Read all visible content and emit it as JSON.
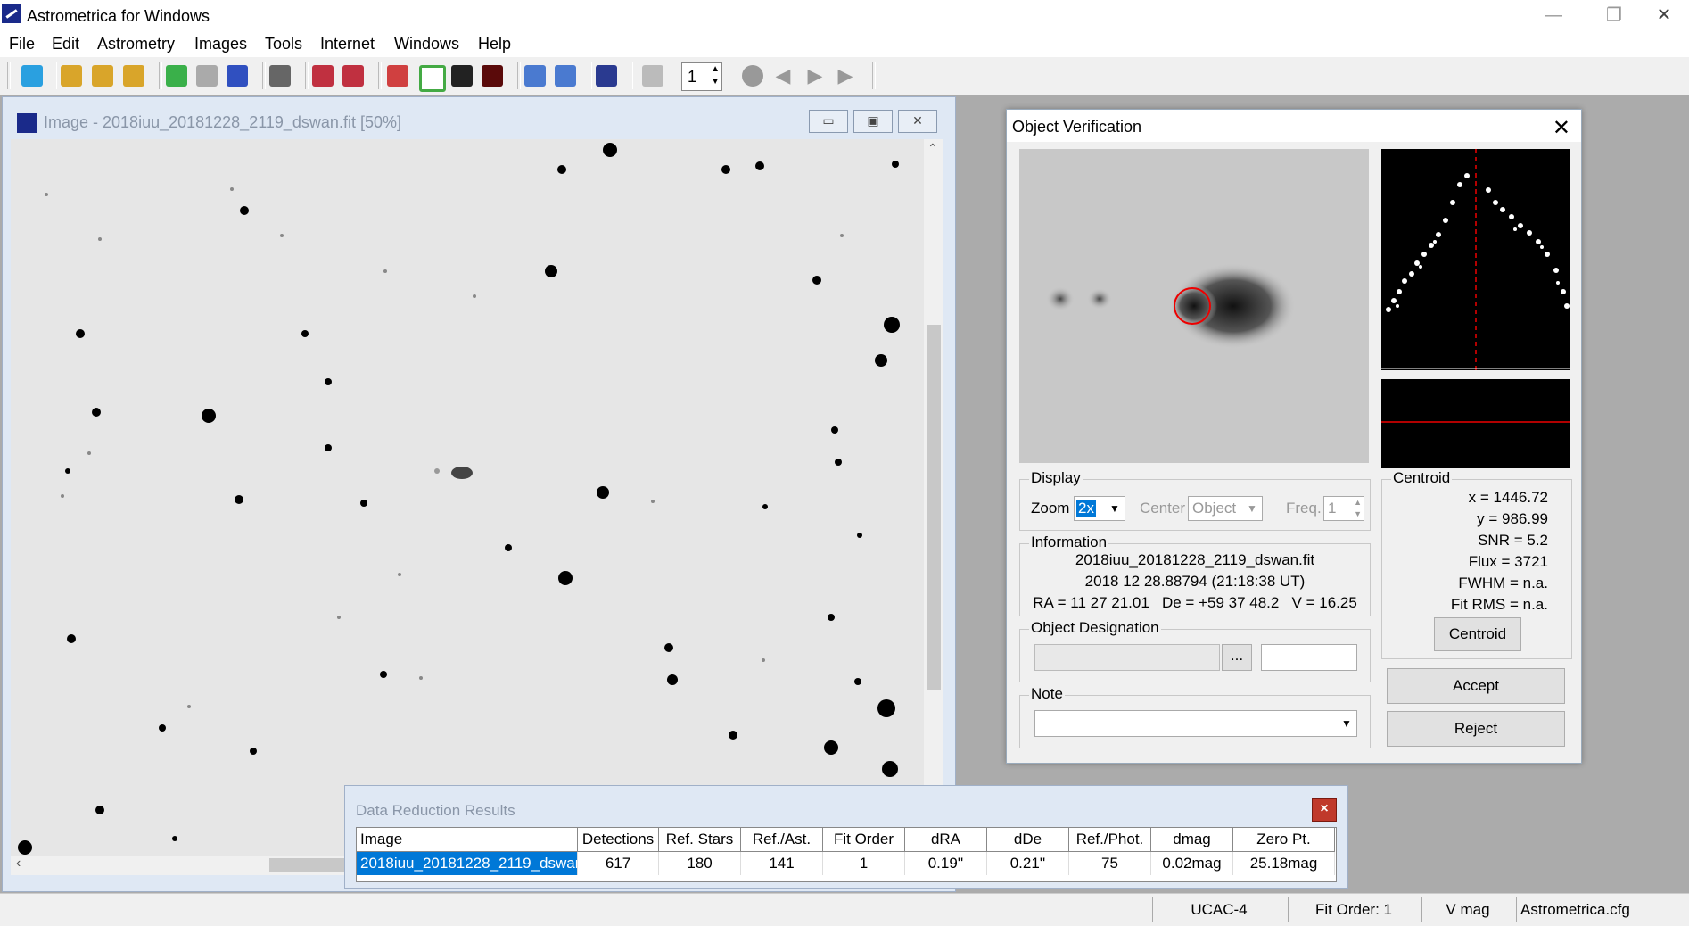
{
  "app": {
    "title": "Astrometrica for Windows"
  },
  "menu": [
    "File",
    "Edit",
    "Astrometry",
    "Images",
    "Tools",
    "Internet",
    "Windows",
    "Help"
  ],
  "toolbar": {
    "frame_value": "1"
  },
  "image_window": {
    "title": "Image - 2018iuu_20181228_2119_dswan.fit [50%]"
  },
  "object_verification": {
    "title": "Object Verification",
    "display": {
      "legend": "Display",
      "zoom_label": "Zoom",
      "zoom_value": "2x",
      "center_label": "Center",
      "center_value": "Object",
      "freq_label": "Freq.",
      "freq_value": "1"
    },
    "information": {
      "legend": "Information",
      "filename": "2018iuu_20181228_2119_dswan.fit",
      "date": "2018 12 28.88794 (21:18:38 UT)",
      "coords": "RA = 11 27 21.01   De = +59 37 48.2   V = 16.25"
    },
    "designation": {
      "legend": "Object Designation",
      "browse_label": "..."
    },
    "note": {
      "legend": "Note"
    },
    "centroid": {
      "legend": "Centroid",
      "x": "x = 1446.72",
      "y": "y = 986.99",
      "snr": "SNR = 5.2",
      "flux": "Flux = 3721",
      "fwhm": "FWHM = n.a.",
      "fit_rms": "Fit RMS = n.a.",
      "button": "Centroid"
    },
    "accept_label": "Accept",
    "reject_label": "Reject"
  },
  "data_reduction": {
    "title": "Data Reduction Results",
    "headers": [
      "Image",
      "Detections",
      "Ref. Stars",
      "Ref./Ast.",
      "Fit Order",
      "dRA",
      "dDe",
      "Ref./Phot.",
      "dmag",
      "Zero Pt."
    ],
    "row": [
      "2018iuu_20181228_2119_dswan",
      "617",
      "180",
      "141",
      "1",
      "0.19''",
      "0.21''",
      "75",
      "0.02mag",
      "25.18mag"
    ]
  },
  "status": {
    "catalog": "UCAC-4",
    "fit_order": "Fit Order: 1",
    "mag": "V mag",
    "config": "Astrometrica.cfg"
  }
}
